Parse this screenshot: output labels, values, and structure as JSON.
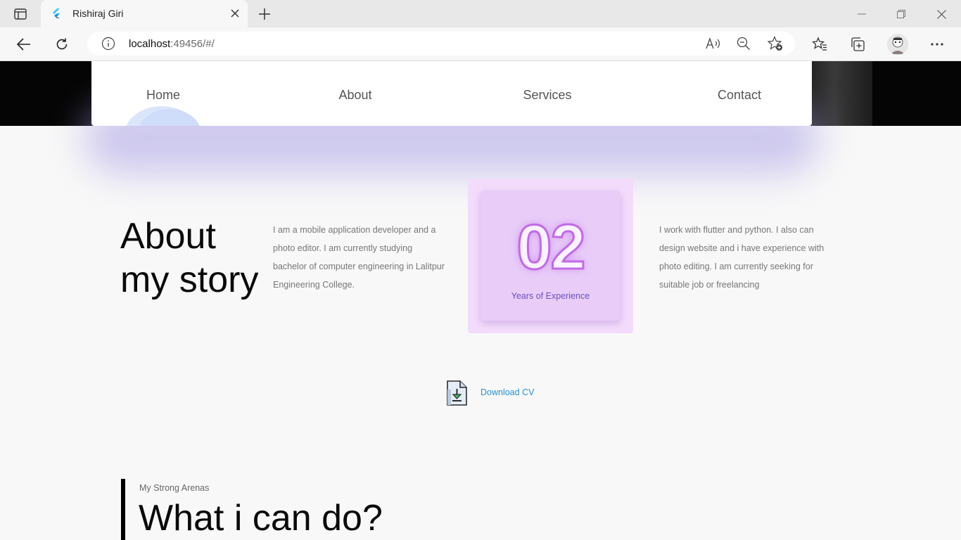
{
  "browser": {
    "tab_title": "Rishiraj Giri",
    "url_host": "localhost",
    "url_rest": ":49456/#/"
  },
  "nav": {
    "items": [
      {
        "label": "Home"
      },
      {
        "label": "About"
      },
      {
        "label": "Services"
      },
      {
        "label": "Contact"
      }
    ]
  },
  "about": {
    "title_line1": "About",
    "title_line2": "my story",
    "left_paragraph": "I am a mobile application developer and a photo editor. I am currently studying bachelor of computer engineering in Lalitpur Engineering College.",
    "right_paragraph": "I work with flutter and python. I also can design website and i have experience with photo editing. I am currently seeking for suitable job or freelancing",
    "experience_number": "02",
    "experience_label": "Years of Experience",
    "cv_label": "Download CV"
  },
  "arenas": {
    "subtitle": "My Strong Arenas",
    "title": "What i can do?"
  },
  "colors": {
    "accent_purple": "#c26ae6",
    "link_blue": "#2a8fd1"
  },
  "icons": [
    "sidebar-icon",
    "flutter-icon",
    "close-icon",
    "plus-icon",
    "minimize-icon",
    "restore-icon",
    "back-icon",
    "refresh-icon",
    "info-icon",
    "read-aloud-icon",
    "zoom-out-icon",
    "add-favorite-icon",
    "favorites-icon",
    "collections-icon",
    "more-icon",
    "download-file-icon"
  ]
}
